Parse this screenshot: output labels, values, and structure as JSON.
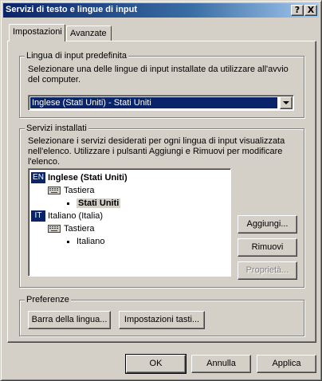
{
  "window": {
    "title": "Servizi di testo e lingue di input",
    "help_button": "?",
    "close_button": "X"
  },
  "tabs": [
    {
      "label": "Impostazioni",
      "active": true
    },
    {
      "label": "Avanzate",
      "active": false
    }
  ],
  "default_language": {
    "group_label": "Lingua di input predefinita",
    "description": "Selezionare una delle lingue di input installate da utilizzare all'avvio del computer.",
    "selected": "Inglese (Stati Uniti) - Stati Uniti"
  },
  "installed_services": {
    "group_label": "Servizi installati",
    "description": "Selezionare i servizi desiderati per ogni lingua di input visualizzata nell'elenco. Utilizzare i pulsanti Aggiungi e Rimuovi per modificare l'elenco.",
    "tree": [
      {
        "badge": "EN",
        "language": "Inglese (Stati Uniti)",
        "category": "Tastiera",
        "layout": "Stati Uniti",
        "bold": true
      },
      {
        "badge": "IT",
        "language": "Italiano (Italia)",
        "category": "Tastiera",
        "layout": "Italiano",
        "bold": false
      }
    ],
    "buttons": {
      "add": "Aggiungi...",
      "remove": "Rimuovi",
      "properties": "Proprietà..."
    }
  },
  "preferences": {
    "group_label": "Preferenze",
    "language_bar": "Barra della lingua...",
    "key_settings": "Impostazioni tasti..."
  },
  "footer": {
    "ok": "OK",
    "cancel": "Annulla",
    "apply": "Applica"
  }
}
